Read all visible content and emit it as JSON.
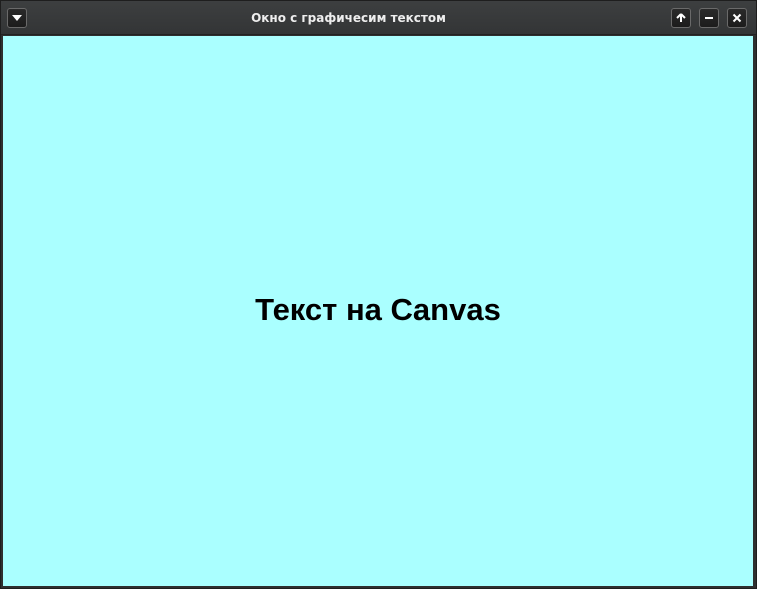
{
  "window": {
    "title": "Окно с графичесим текстом",
    "controls": {
      "menu_icon": "chevron-down-icon",
      "maximize_icon": "arrow-up-icon",
      "minimize_icon": "minus-icon",
      "close_icon": "close-icon"
    }
  },
  "canvas": {
    "text": "Текст на Canvas",
    "background_color": "#aaffff",
    "text_color": "#000000"
  }
}
